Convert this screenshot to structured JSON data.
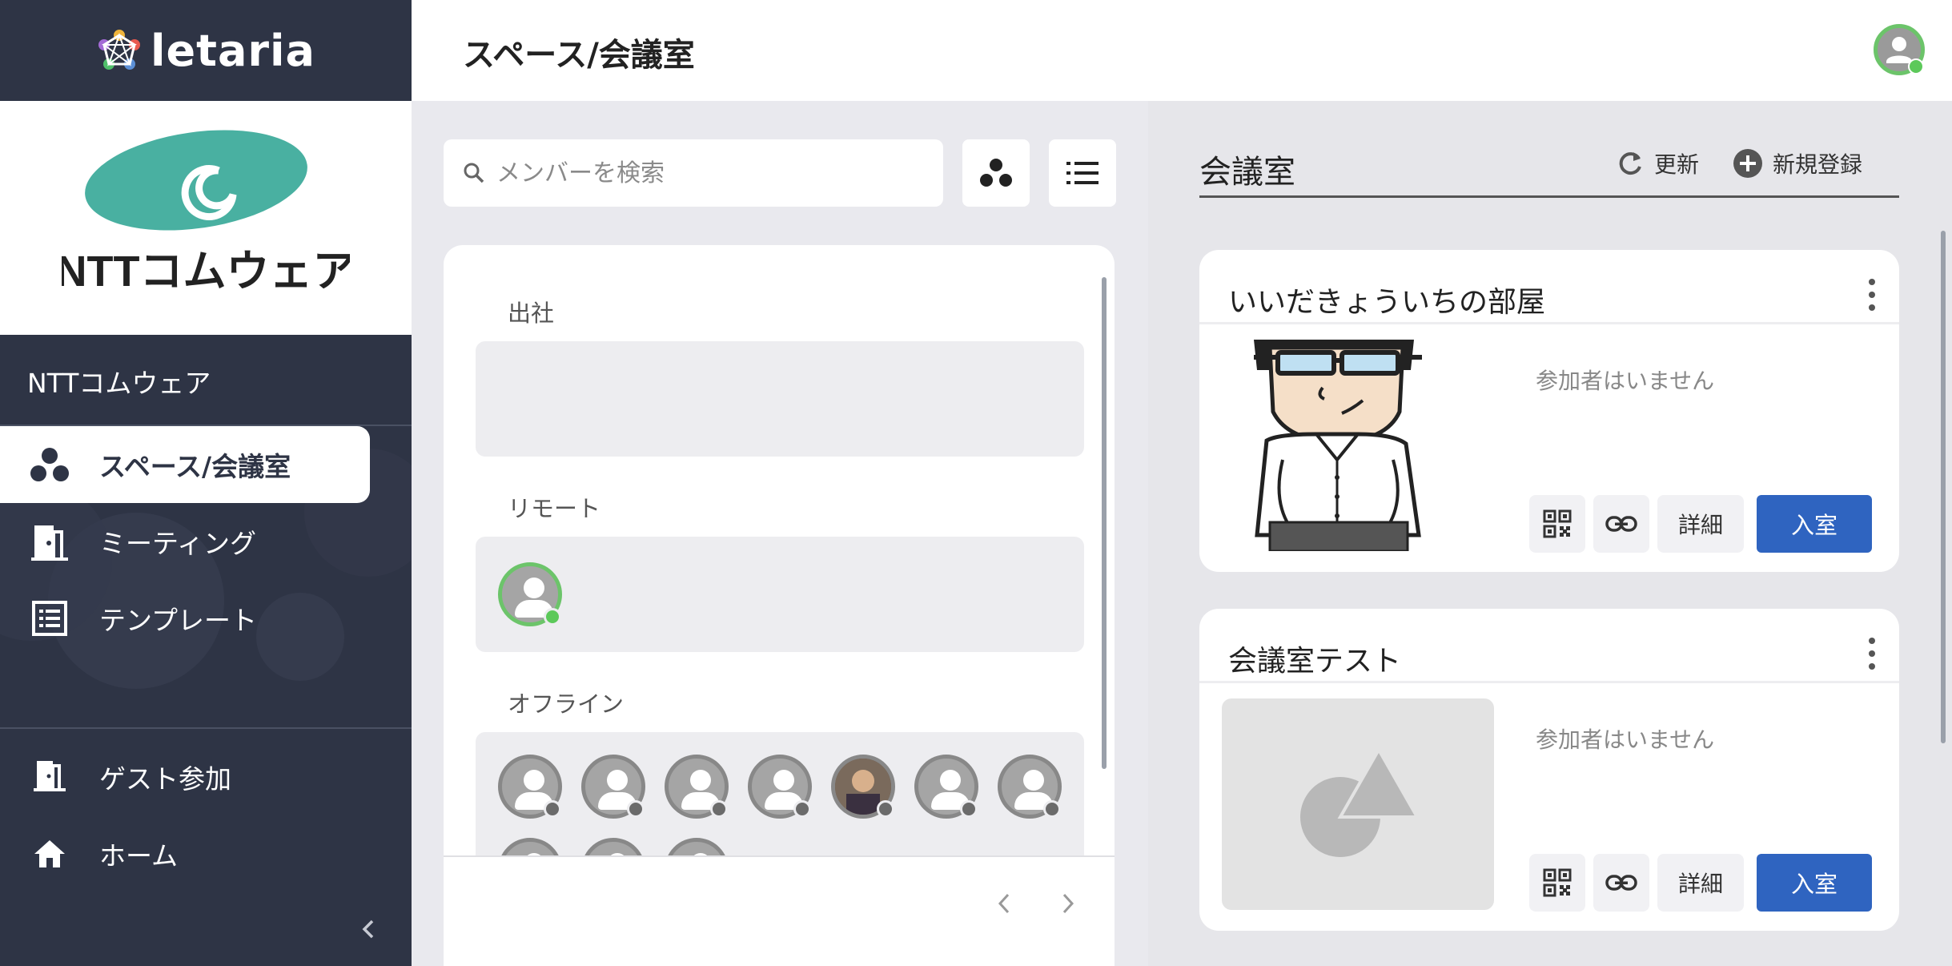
{
  "app": {
    "brand": "letaria"
  },
  "sidebar": {
    "org_name": "NTTコムウェア",
    "org_logo_text": "NTTコムウェア",
    "nav": [
      {
        "label": "スペース/会議室",
        "icon": "space-icon"
      },
      {
        "label": "ミーティング",
        "icon": "door-icon"
      },
      {
        "label": "テンプレート",
        "icon": "template-icon"
      }
    ],
    "bottom_nav": [
      {
        "label": "ゲスト参加",
        "icon": "guest-door-icon"
      },
      {
        "label": "ホーム",
        "icon": "home-icon"
      }
    ],
    "collapse_icon": "chevron-left-icon"
  },
  "header": {
    "title": "スペース/会議室"
  },
  "members": {
    "search_placeholder": "メンバーを検索",
    "groups": [
      {
        "label": "出社",
        "count": 0
      },
      {
        "label": "リモート",
        "count": 1
      },
      {
        "label": "オフライン",
        "count": 10
      }
    ]
  },
  "rooms": {
    "title": "会議室",
    "refresh_label": "更新",
    "new_label": "新規登録",
    "items": [
      {
        "name": "いいだきょういちの部屋",
        "status": "参加者はいません",
        "detail_label": "詳細",
        "enter_label": "入室"
      },
      {
        "name": "会議室テスト",
        "status": "参加者はいません",
        "detail_label": "詳細",
        "enter_label": "入室"
      }
    ]
  },
  "colors": {
    "sidebar": "#2e3445",
    "accent": "#2f64c0",
    "online": "#5cc95a"
  }
}
